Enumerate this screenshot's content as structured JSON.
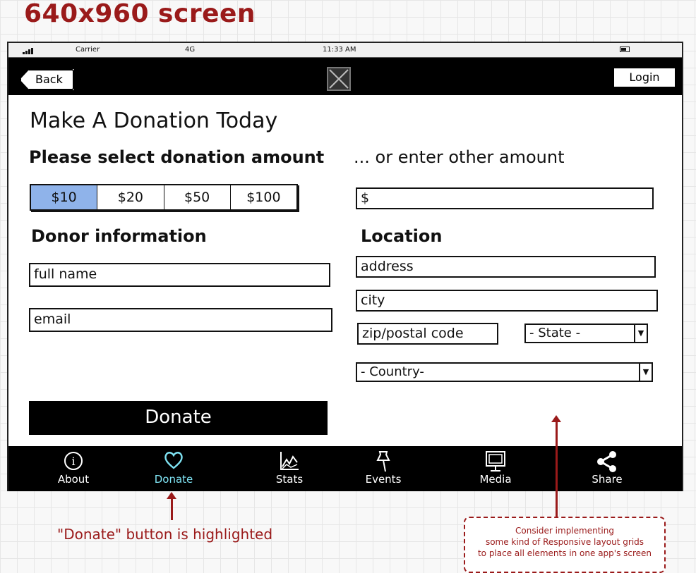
{
  "page_title": "640x960 screen",
  "statusbar": {
    "carrier": "Carrier",
    "network": "4G",
    "time": "11:33 AM"
  },
  "navbar": {
    "back_label": "Back",
    "login_label": "Login"
  },
  "main": {
    "heading": "Make A Donation Today",
    "amount_label": "Please select donation amount",
    "amounts": [
      "$10",
      "$20",
      "$50",
      "$100"
    ],
    "selected_amount": "$10",
    "other_label": "... or enter other amount",
    "other_value": "$",
    "donor_label": "Donor information",
    "fullname_placeholder": "full name",
    "email_placeholder": "email",
    "donate_label": "Donate",
    "location_label": "Location",
    "address_placeholder": "address",
    "city_placeholder": "city",
    "zip_placeholder": "zip/postal code",
    "state_select": "- State -",
    "country_select": "- Country-"
  },
  "tabbar": {
    "items": [
      {
        "label": "About",
        "icon": "info-icon"
      },
      {
        "label": "Donate",
        "icon": "heart-icon",
        "active": true
      },
      {
        "label": "Stats",
        "icon": "chart-icon"
      },
      {
        "label": "Events",
        "icon": "pin-icon"
      },
      {
        "label": "Media",
        "icon": "monitor-icon"
      },
      {
        "label": "Share",
        "icon": "share-icon"
      }
    ]
  },
  "annotations": {
    "donate_note": "\"Donate\" button is highlighted",
    "grid_note_lines": [
      "Consider implementing",
      "some kind of Responsive layout grids",
      "to place all elements in one app's screen"
    ]
  },
  "colors": {
    "accent_annotation": "#9a1a1a",
    "active_tab": "#7fe3f3",
    "selected_amount": "#8fb3ea"
  }
}
